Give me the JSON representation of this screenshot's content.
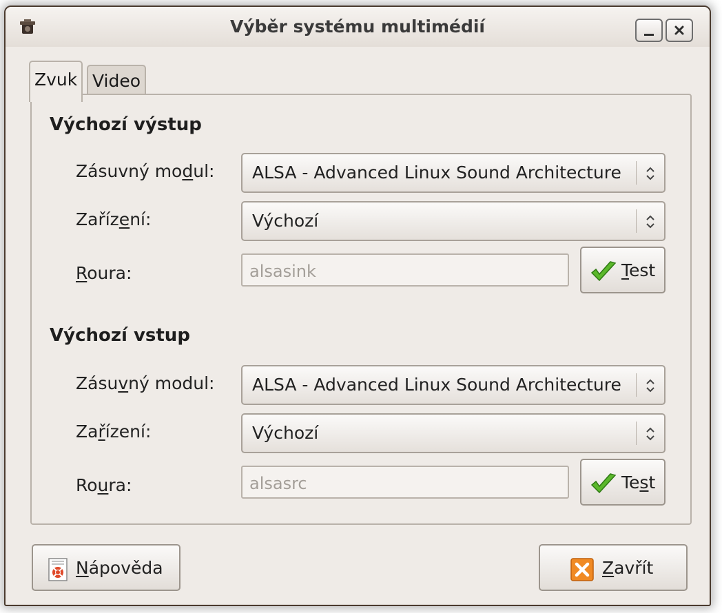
{
  "window": {
    "title": "Výběr systému multimédií"
  },
  "tabs": [
    {
      "label": "Zvuk",
      "active": true
    },
    {
      "label": "Video",
      "active": false
    }
  ],
  "output": {
    "section_title": "Výchozí výstup",
    "plugin": {
      "label_pre": "Zásuvný mo",
      "label_mn": "d",
      "label_post": "ul:",
      "value": "ALSA - Advanced Linux Sound Architecture"
    },
    "device": {
      "label_pre": "Zaříz",
      "label_mn": "e",
      "label_post": "ní:",
      "value": "Výchozí"
    },
    "pipeline": {
      "label_pre": "",
      "label_mn": "R",
      "label_post": "oura:",
      "value": "alsasink"
    },
    "test": {
      "label_pre": "",
      "label_mn": "T",
      "label_post": "est"
    }
  },
  "input": {
    "section_title": "Výchozí vstup",
    "plugin": {
      "label_pre": "Zásu",
      "label_mn": "v",
      "label_post": "ný modul:",
      "value": "ALSA - Advanced Linux Sound Architecture"
    },
    "device": {
      "label_pre": "Za",
      "label_mn": "ř",
      "label_post": "ízení:",
      "value": "Výchozí"
    },
    "pipeline": {
      "label_pre": "Ro",
      "label_mn": "u",
      "label_post": "ra:",
      "value": "alsasrc"
    },
    "test": {
      "label_pre": "Te",
      "label_mn": "s",
      "label_post": "t"
    }
  },
  "buttons": {
    "help": {
      "label_pre": "",
      "label_mn": "N",
      "label_post": "ápověda"
    },
    "close": {
      "label_pre": "",
      "label_mn": "Z",
      "label_post": "avřít"
    }
  },
  "icons": {
    "app": "multimedia-icon",
    "minimize": "minimize-icon",
    "close_window": "close-icon",
    "combo": "spin-arrows-icon",
    "test": "checkmark-icon",
    "help": "help-icon",
    "close": "close-x-icon"
  },
  "colors": {
    "window_bg": "#efebe7",
    "frame": "#4a3a2e",
    "check_green": "#5bb82b",
    "close_orange": "#f08a24"
  }
}
